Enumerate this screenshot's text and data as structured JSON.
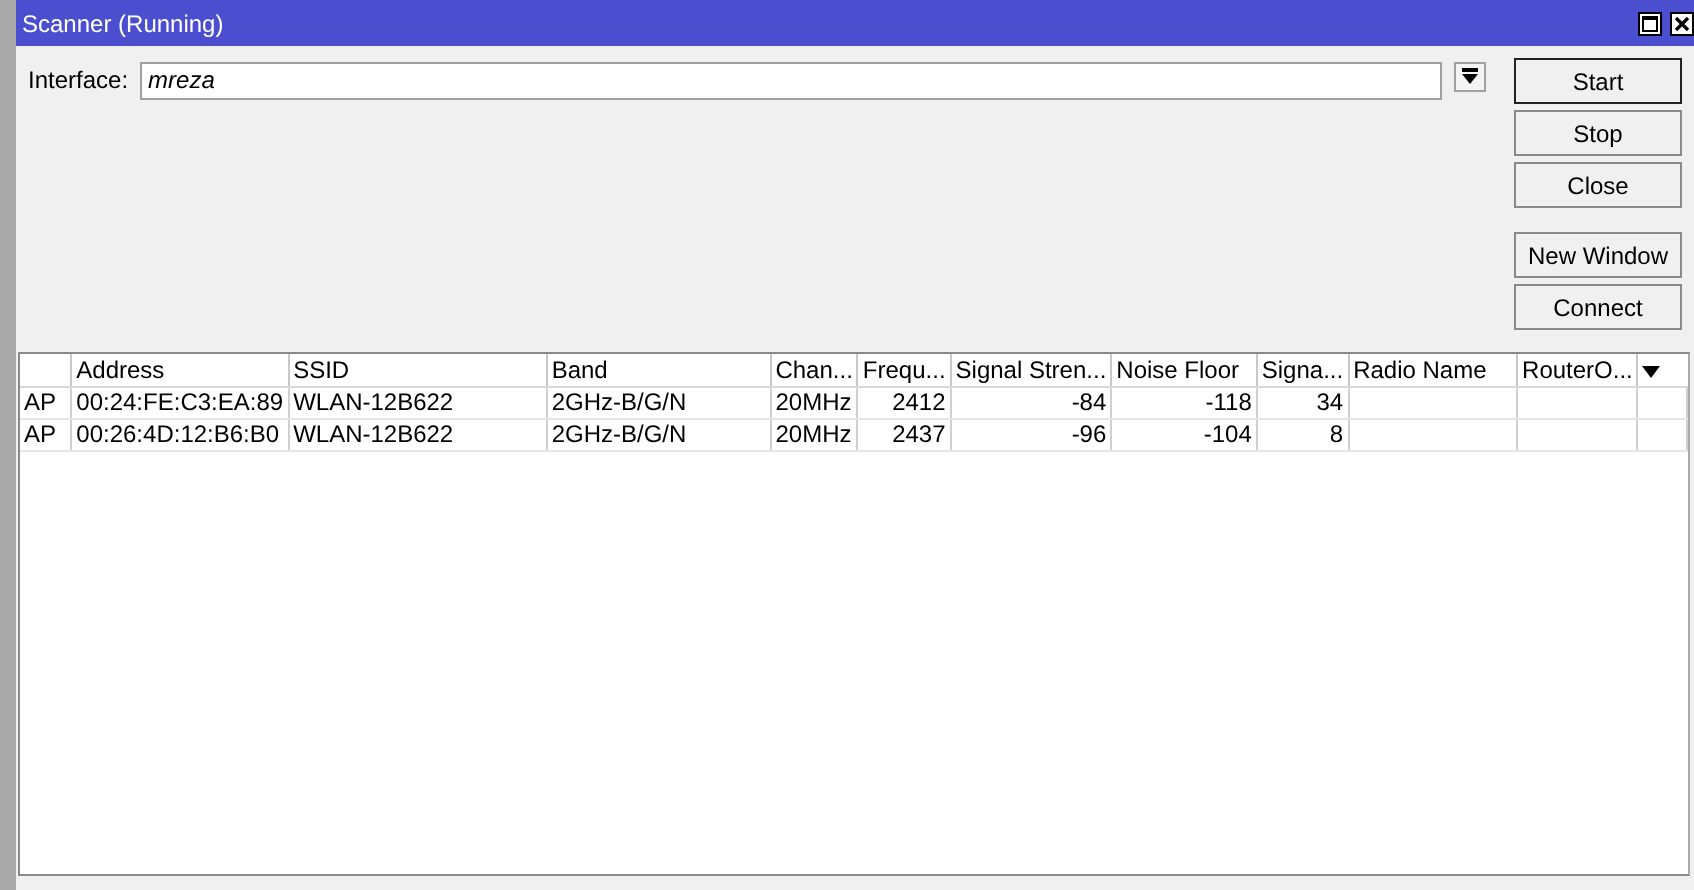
{
  "window": {
    "title": "Scanner (Running)"
  },
  "interface": {
    "label": "Interface:",
    "value": "mreza"
  },
  "button_groups": [
    [
      {
        "label": "Start",
        "focused": true
      },
      {
        "label": "Stop",
        "focused": false
      },
      {
        "label": "Close",
        "focused": false
      }
    ],
    [
      {
        "label": "New Window",
        "focused": false
      },
      {
        "label": "Connect",
        "focused": false
      }
    ]
  ],
  "table": {
    "columns": [
      {
        "kind": "text"
      },
      {
        "label": "Address",
        "kind": "text"
      },
      {
        "label": "SSID",
        "kind": "text"
      },
      {
        "label": "Band",
        "kind": "text"
      },
      {
        "label": "Chan...",
        "kind": "text"
      },
      {
        "label": "Frequ...",
        "kind": "number"
      },
      {
        "label": "Signal Stren...",
        "kind": "number"
      },
      {
        "label": "Noise Floor",
        "kind": "number"
      },
      {
        "label": "Signa...",
        "kind": "number"
      },
      {
        "label": "Radio Name",
        "kind": "text"
      },
      {
        "label": "RouterO...",
        "kind": "text"
      }
    ],
    "rows": [
      [
        "AP",
        "00:24:FE:C3:EA:89",
        "WLAN-12B622",
        "2GHz-B/G/N",
        "20MHz",
        "2412",
        "-84",
        "-118",
        "34",
        "",
        ""
      ],
      [
        "AP",
        "00:26:4D:12:B6:B0",
        "WLAN-12B622",
        "2GHz-B/G/N",
        "20MHz",
        "2437",
        "-96",
        "-104",
        "8",
        "",
        ""
      ]
    ]
  }
}
